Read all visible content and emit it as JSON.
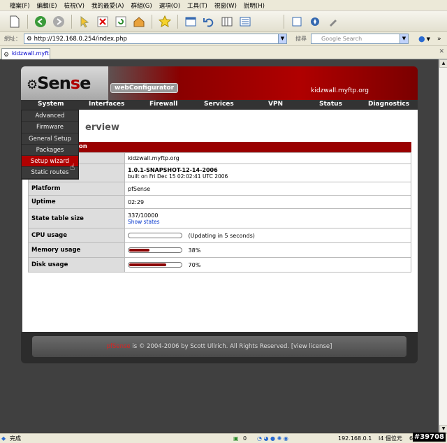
{
  "menubar": [
    "檔案(F)",
    "編輯(E)",
    "檢視(V)",
    "我的最愛(A)",
    "群組(G)",
    "選項(O)",
    "工具(T)",
    "視窗(W)",
    "說明(H)"
  ],
  "address": {
    "label": "網址：",
    "url": "http://192.168.0.254/index.php"
  },
  "search": {
    "label": "搜尋",
    "placeholder": "Google Search"
  },
  "tab": {
    "title": "kidzwall.myft..."
  },
  "header": {
    "logo_prefix": "pf",
    "logo_main": "Sen",
    "logo_s": "s",
    "logo_e": "e",
    "badge": "webConfigurator",
    "hostname": "kidzwall.myftp.org"
  },
  "nav": [
    "System",
    "Interfaces",
    "Firewall",
    "Services",
    "VPN",
    "Status",
    "Diagnostics"
  ],
  "dropdown": [
    "Advanced",
    "Firmware",
    "General Setup",
    "Packages",
    "Setup wizard",
    "Static routes"
  ],
  "page": {
    "title": "erview",
    "section": "ion"
  },
  "rows": [
    {
      "key": "",
      "value": "kidzwall.myftp.org"
    },
    {
      "key": "",
      "value": "1.0.1-SNAPSHOT-12-14-2006",
      "sub": "built on Fri Dec 15 02:02:41 UTC 2006"
    },
    {
      "key": "Platform",
      "value": "pfSense"
    },
    {
      "key": "Uptime",
      "value": "02:29"
    },
    {
      "key": "State table size",
      "value": "337/10000",
      "link": "Show states"
    },
    {
      "key": "CPU usage",
      "value": "(Updating in 5 seconds)",
      "fill": 0.0
    },
    {
      "key": "Memory usage",
      "value": "38%",
      "fill": 0.38
    },
    {
      "key": "Disk usage",
      "value": "70%",
      "fill": 0.7
    }
  ],
  "footer": {
    "brand": "pfSense",
    "text": " is © 2004-2006 by Scott Ullrich. All Rights Reserved. [view license]"
  },
  "statusbar": {
    "done": "完成",
    "count": "0",
    "ip": "192.168.0.1",
    "misc": "l4 個位元",
    "digit": "6"
  },
  "watermark": "#39708"
}
